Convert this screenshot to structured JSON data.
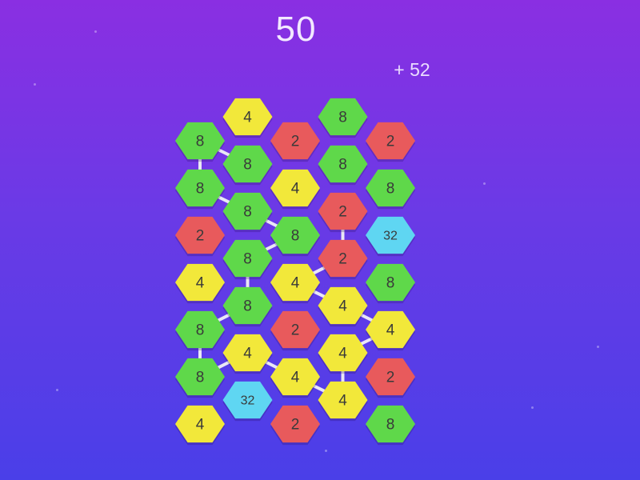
{
  "score": "50",
  "bonus": "+ 52",
  "colors": {
    "2": "#e85a5c",
    "4": "#f2e83a",
    "8": "#5fd84a",
    "32": "#5fd6f2",
    "chain": "#e9e6f5"
  },
  "board": {
    "columns": 5,
    "rows": 7,
    "cells": [
      {
        "col": 0,
        "row": 0,
        "value": 8
      },
      {
        "col": 0,
        "row": 1,
        "value": 8
      },
      {
        "col": 0,
        "row": 2,
        "value": 2
      },
      {
        "col": 0,
        "row": 3,
        "value": 4
      },
      {
        "col": 0,
        "row": 4,
        "value": 8
      },
      {
        "col": 0,
        "row": 5,
        "value": 8
      },
      {
        "col": 0,
        "row": 6,
        "value": 4
      },
      {
        "col": 1,
        "row": 0,
        "value": 4
      },
      {
        "col": 1,
        "row": 1,
        "value": 8
      },
      {
        "col": 1,
        "row": 2,
        "value": 8
      },
      {
        "col": 1,
        "row": 3,
        "value": 8
      },
      {
        "col": 1,
        "row": 4,
        "value": 8
      },
      {
        "col": 1,
        "row": 5,
        "value": 4
      },
      {
        "col": 1,
        "row": 6,
        "value": 32
      },
      {
        "col": 2,
        "row": 0,
        "value": 2
      },
      {
        "col": 2,
        "row": 1,
        "value": 4
      },
      {
        "col": 2,
        "row": 2,
        "value": 8
      },
      {
        "col": 2,
        "row": 3,
        "value": 4
      },
      {
        "col": 2,
        "row": 4,
        "value": 2
      },
      {
        "col": 2,
        "row": 5,
        "value": 4
      },
      {
        "col": 2,
        "row": 6,
        "value": 2
      },
      {
        "col": 3,
        "row": 0,
        "value": 8
      },
      {
        "col": 3,
        "row": 1,
        "value": 8
      },
      {
        "col": 3,
        "row": 2,
        "value": 2
      },
      {
        "col": 3,
        "row": 3,
        "value": 2
      },
      {
        "col": 3,
        "row": 4,
        "value": 4
      },
      {
        "col": 3,
        "row": 5,
        "value": 4
      },
      {
        "col": 3,
        "row": 6,
        "value": 4
      },
      {
        "col": 4,
        "row": 0,
        "value": 2
      },
      {
        "col": 4,
        "row": 1,
        "value": 8
      },
      {
        "col": 4,
        "row": 2,
        "value": 32
      },
      {
        "col": 4,
        "row": 3,
        "value": 8
      },
      {
        "col": 4,
        "row": 4,
        "value": 4
      },
      {
        "col": 4,
        "row": 5,
        "value": 2
      },
      {
        "col": 4,
        "row": 6,
        "value": 8
      }
    ],
    "chains": [
      [
        [
          0,
          0
        ],
        [
          1,
          1
        ]
      ],
      [
        [
          0,
          0
        ],
        [
          0,
          1
        ]
      ],
      [
        [
          0,
          1
        ],
        [
          1,
          2
        ]
      ],
      [
        [
          1,
          2
        ],
        [
          2,
          2
        ]
      ],
      [
        [
          2,
          2
        ],
        [
          1,
          3
        ]
      ],
      [
        [
          1,
          3
        ],
        [
          1,
          4
        ]
      ],
      [
        [
          1,
          4
        ],
        [
          0,
          4
        ]
      ],
      [
        [
          0,
          4
        ],
        [
          0,
          5
        ]
      ],
      [
        [
          0,
          5
        ],
        [
          1,
          5
        ]
      ],
      [
        [
          1,
          5
        ],
        [
          2,
          5
        ]
      ],
      [
        [
          2,
          5
        ],
        [
          3,
          6
        ]
      ],
      [
        [
          3,
          6
        ],
        [
          3,
          5
        ]
      ],
      [
        [
          3,
          5
        ],
        [
          4,
          4
        ]
      ],
      [
        [
          4,
          4
        ],
        [
          3,
          4
        ]
      ],
      [
        [
          3,
          4
        ],
        [
          2,
          3
        ]
      ],
      [
        [
          2,
          3
        ],
        [
          3,
          3
        ]
      ],
      [
        [
          3,
          3
        ],
        [
          3,
          2
        ]
      ]
    ]
  }
}
